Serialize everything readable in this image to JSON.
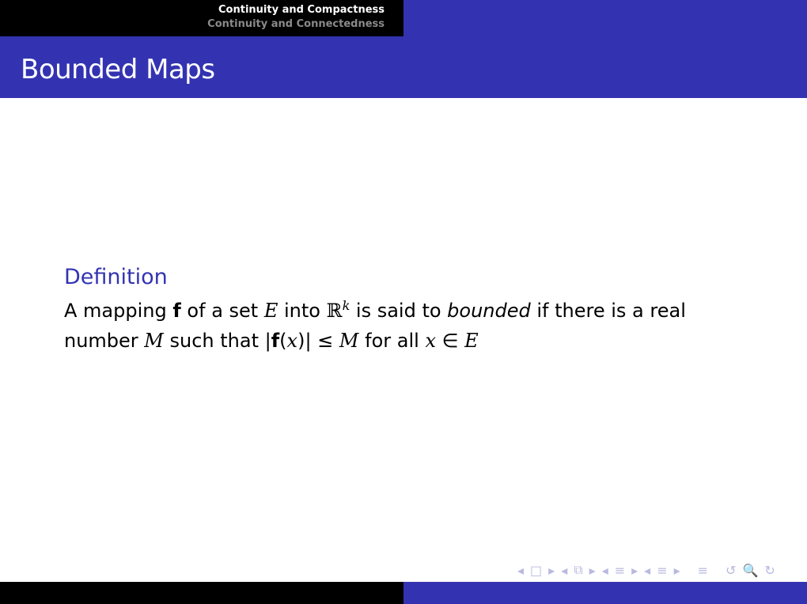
{
  "header": {
    "section_current": "Continuity and Compactness",
    "section_next": "Continuity and Connectedness"
  },
  "slide": {
    "title": "Bounded Maps"
  },
  "definition": {
    "title": "Definition",
    "t1": "A mapping ",
    "f1": "f",
    "t2": " of a set ",
    "E1": "E",
    "t3": " into ",
    "R": "ℝ",
    "k": "k",
    "t4": " is said to ",
    "bounded": "bounded",
    "t5": " if there is a real number ",
    "M1": "M",
    "t6": " such that |",
    "f2": "f",
    "t7": "(",
    "x1": "x",
    "t8": ")| ≤ ",
    "M2": "M",
    "t9": " for all ",
    "x2": "x",
    "t10": " ∈ ",
    "E2": "E"
  },
  "nav": {
    "icons": [
      "◂",
      "□",
      "▸",
      "◂",
      "⧉",
      "▸",
      "◂",
      "≡",
      "▸",
      "◂",
      "≡",
      "▸",
      "≡",
      "↺",
      "🔍",
      "↻"
    ]
  }
}
